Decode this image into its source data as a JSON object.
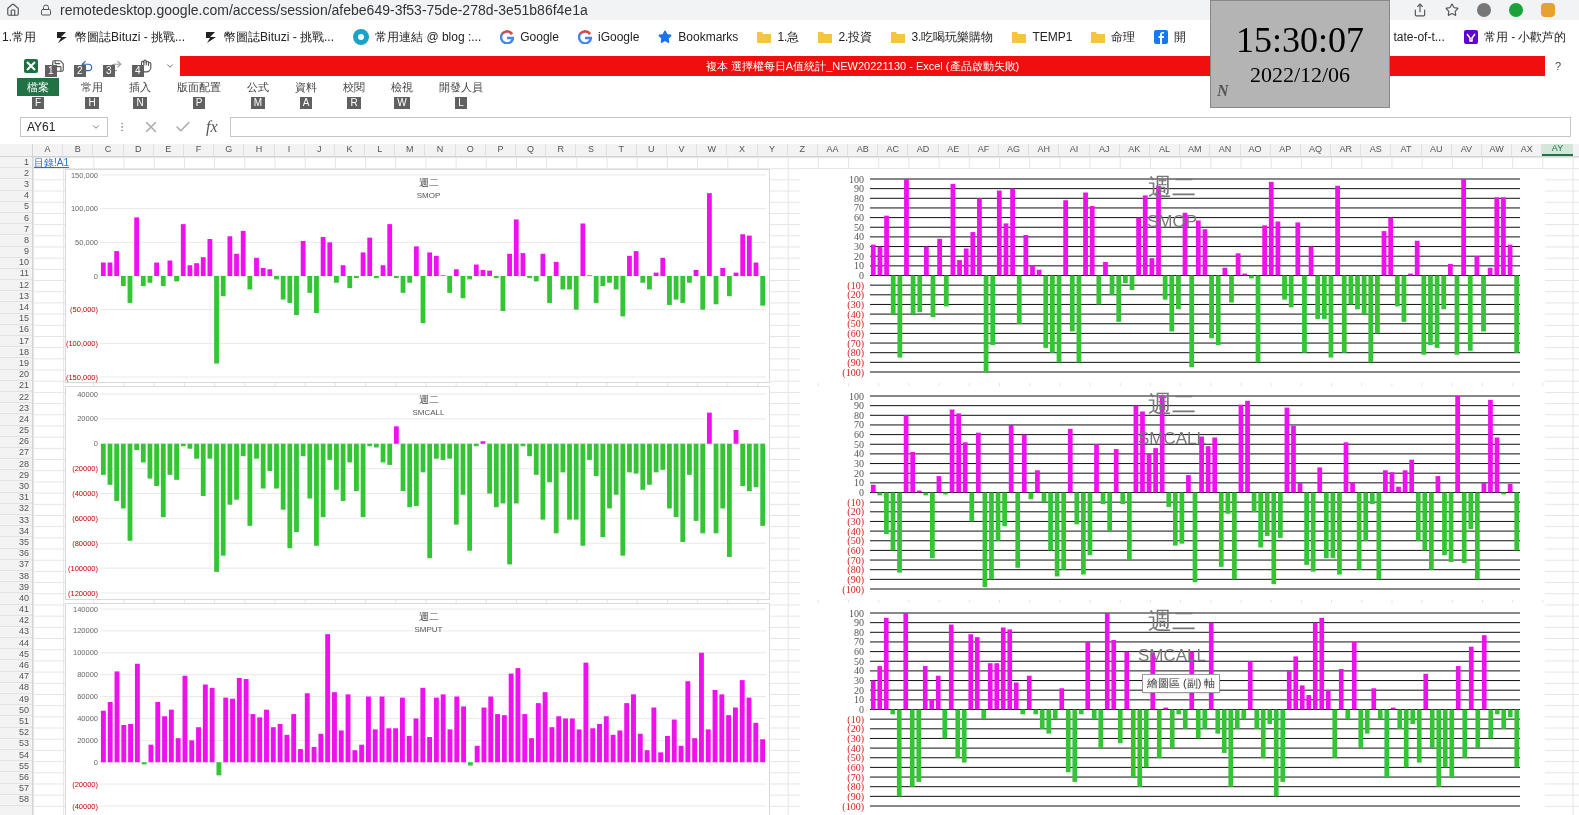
{
  "browser": {
    "url": "remotedesktop.google.com/access/session/afebe649-3f53-75de-278d-3e51b86f4e1a",
    "bookmarks": [
      {
        "kind": "plain",
        "label": "1.常用"
      },
      {
        "kind": "bituzi",
        "label": "幣圖誌Bituzi - 挑戰..."
      },
      {
        "kind": "bituzi",
        "label": "幣圖誌Bituzi - 挑戰..."
      },
      {
        "kind": "blog",
        "label": "常用連結 @ blog :..."
      },
      {
        "kind": "google",
        "label": "Google"
      },
      {
        "kind": "google",
        "label": "iGoogle"
      },
      {
        "kind": "star",
        "label": "Bookmarks"
      },
      {
        "kind": "folder",
        "label": "1.急"
      },
      {
        "kind": "folder",
        "label": "2.投資"
      },
      {
        "kind": "folder",
        "label": "3.吃喝玩樂購物"
      },
      {
        "kind": "folder",
        "label": "TEMP1"
      },
      {
        "kind": "folder",
        "label": "命理"
      },
      {
        "kind": "facebook",
        "label": "開"
      },
      {
        "kind": "plain",
        "label": "tate-of-t..."
      },
      {
        "kind": "yahoo",
        "label": "常用 - 小歡芦的"
      }
    ]
  },
  "clock": {
    "time": "15:30:07",
    "date": "2022/12/06",
    "mark": "N"
  },
  "excel": {
    "title": "複本 選擇權每日A值統計_NEW20221130 -  Excel (產品啟動失敗)",
    "help": "?",
    "quick_access": [
      {
        "kind": "save",
        "keytip": "1"
      },
      {
        "kind": "undo",
        "keytip": "2"
      },
      {
        "kind": "redo",
        "keytip": "3"
      },
      {
        "kind": "touch",
        "keytip": "4"
      }
    ],
    "tabs": [
      {
        "kind": "file",
        "label": "檔案",
        "keytip": "F"
      },
      {
        "kind": "tab",
        "label": "常用",
        "keytip": "H"
      },
      {
        "kind": "tab",
        "label": "插入",
        "keytip": "N"
      },
      {
        "kind": "tab",
        "label": "版面配置",
        "keytip": "P"
      },
      {
        "kind": "tab",
        "label": "公式",
        "keytip": "M"
      },
      {
        "kind": "tab",
        "label": "資料",
        "keytip": "A"
      },
      {
        "kind": "tab",
        "label": "校閱",
        "keytip": "R"
      },
      {
        "kind": "tab",
        "label": "檢視",
        "keytip": "W"
      },
      {
        "kind": "tab",
        "label": "開發人員",
        "keytip": "L"
      }
    ],
    "name_box": "AY61",
    "fx": "fx",
    "columns": [
      {
        "label": "A",
        "selected": false
      },
      {
        "label": "B",
        "selected": false
      },
      {
        "label": "C",
        "selected": false
      },
      {
        "label": "D",
        "selected": false
      },
      {
        "label": "E",
        "selected": false
      },
      {
        "label": "F",
        "selected": false
      },
      {
        "label": "G",
        "selected": false
      },
      {
        "label": "H",
        "selected": false
      },
      {
        "label": "I",
        "selected": false
      },
      {
        "label": "J",
        "selected": false
      },
      {
        "label": "K",
        "selected": false
      },
      {
        "label": "L",
        "selected": false
      },
      {
        "label": "M",
        "selected": false
      },
      {
        "label": "N",
        "selected": false
      },
      {
        "label": "O",
        "selected": false
      },
      {
        "label": "P",
        "selected": false
      },
      {
        "label": "Q",
        "selected": false
      },
      {
        "label": "R",
        "selected": false
      },
      {
        "label": "S",
        "selected": false
      },
      {
        "label": "T",
        "selected": false
      },
      {
        "label": "U",
        "selected": false
      },
      {
        "label": "V",
        "selected": false
      },
      {
        "label": "W",
        "selected": false
      },
      {
        "label": "X",
        "selected": false
      },
      {
        "label": "Y",
        "selected": false
      },
      {
        "label": "Z",
        "selected": false
      },
      {
        "label": "AA",
        "selected": false
      },
      {
        "label": "AB",
        "selected": false
      },
      {
        "label": "AC",
        "selected": false
      },
      {
        "label": "AD",
        "selected": false
      },
      {
        "label": "AE",
        "selected": false
      },
      {
        "label": "AF",
        "selected": false
      },
      {
        "label": "AG",
        "selected": false
      },
      {
        "label": "AH",
        "selected": false
      },
      {
        "label": "AI",
        "selected": false
      },
      {
        "label": "AJ",
        "selected": false
      },
      {
        "label": "AK",
        "selected": false
      },
      {
        "label": "AL",
        "selected": false
      },
      {
        "label": "AM",
        "selected": false
      },
      {
        "label": "AN",
        "selected": false
      },
      {
        "label": "AO",
        "selected": false
      },
      {
        "label": "AP",
        "selected": false
      },
      {
        "label": "AQ",
        "selected": false
      },
      {
        "label": "AR",
        "selected": false
      },
      {
        "label": "AS",
        "selected": false
      },
      {
        "label": "AT",
        "selected": false
      },
      {
        "label": "AU",
        "selected": false
      },
      {
        "label": "AV",
        "selected": false
      },
      {
        "label": "AW",
        "selected": false
      },
      {
        "label": "AX",
        "selected": false
      },
      {
        "label": "AY",
        "selected": true
      }
    ],
    "rows": [
      "1",
      "2",
      "3",
      "4",
      "5",
      "6",
      "7",
      "8",
      "9",
      "10",
      "11",
      "12",
      "13",
      "14",
      "15",
      "16",
      "17",
      "18",
      "19",
      "20",
      "21",
      "22",
      "23",
      "24",
      "25",
      "26",
      "27",
      "28",
      "29",
      "30",
      "31",
      "32",
      "33",
      "34",
      "35",
      "36",
      "37",
      "38",
      "39",
      "40",
      "41",
      "42",
      "43",
      "44",
      "45",
      "46",
      "47",
      "48",
      "49",
      "50",
      "51",
      "52",
      "53",
      "54",
      "55",
      "56",
      "57",
      "58"
    ],
    "cell_a1": "目錄!A1",
    "charts": [
      {
        "kind": "standard",
        "title": "週二",
        "subtitle": "SMOP",
        "chart_data": {
          "type": "bar",
          "grid": true,
          "ylim": [
            -150000,
            150000
          ],
          "yticks": [
            {
              "value": 150000,
              "label": "150,000"
            },
            {
              "value": 100000,
              "label": "100,000"
            },
            {
              "value": 50000,
              "label": "50,000"
            },
            {
              "value": 0,
              "label": "0"
            },
            {
              "value": -50000,
              "label": "(50,000)"
            },
            {
              "value": -100000,
              "label": "(100,000)"
            },
            {
              "value": -150000,
              "label": "(150,000)"
            }
          ],
          "values": [
            20000,
            20000,
            37000,
            -15000,
            -40000,
            87000,
            -15000,
            -10000,
            20000,
            -15000,
            23000,
            -8000,
            77000,
            16000,
            19000,
            28000,
            55000,
            -130000,
            -30000,
            59000,
            33000,
            67000,
            -20000,
            27000,
            12000,
            10000,
            -5000,
            -35000,
            -40000,
            -58000,
            52000,
            -25000,
            -55000,
            58000,
            50000,
            -10000,
            16000,
            -18000,
            -3000,
            35000,
            57000,
            -3000,
            16000,
            77000,
            -3000,
            -25000,
            -10000,
            44000,
            -70000,
            35000,
            30000,
            1000,
            -25000,
            10000,
            -33000,
            -5000,
            17000,
            9000,
            8000,
            -3000,
            -52000,
            33000,
            84000,
            34000,
            -3000,
            -8000,
            33000,
            -40000,
            21000,
            -20000,
            -20000,
            -50000,
            78000,
            1000,
            -40000,
            -15000,
            -10000,
            -20000,
            -60000,
            30000,
            37000,
            -10000,
            -20000,
            5000,
            27000,
            -43000,
            -35000,
            -40000,
            -10000,
            9000,
            -50000,
            123000,
            -42000,
            12000,
            -30000,
            5000,
            62000,
            60000,
            20000,
            -44000
          ]
        }
      },
      {
        "kind": "percent",
        "title": "週二",
        "subtitle": "SMOP",
        "chart_data": {
          "type": "bar",
          "grid": true,
          "ylim": [
            -100,
            100
          ],
          "yticks": [
            100,
            90,
            80,
            70,
            60,
            50,
            40,
            30,
            20,
            10,
            0,
            {
              "value": -10,
              "label": "(10)"
            },
            {
              "value": -20,
              "label": "(20)"
            },
            {
              "value": -30,
              "label": "(30)"
            },
            {
              "value": -40,
              "label": "(40)"
            },
            {
              "value": -50,
              "label": "(50)"
            },
            {
              "value": -60,
              "label": "(60)"
            },
            {
              "value": -70,
              "label": "(70)"
            },
            {
              "value": -80,
              "label": "(80)"
            },
            {
              "value": -90,
              "label": "(90)"
            },
            {
              "value": -100,
              "label": "(100)"
            }
          ],
          "values": [
            32,
            30,
            62,
            -40,
            -85,
            100,
            -40,
            -38,
            30,
            -43,
            38,
            -32,
            95,
            16,
            28,
            45,
            80,
            -100,
            -72,
            88,
            54,
            90,
            -50,
            42,
            10,
            6,
            -75,
            -80,
            -90,
            78,
            -58,
            -90,
            86,
            72,
            -30,
            14,
            -20,
            -48,
            -8,
            -15,
            60,
            83,
            18,
            93,
            -25,
            -58,
            -35,
            65,
            -95,
            57,
            48,
            -65,
            -72,
            8,
            -28,
            23,
            2,
            -3,
            -90,
            52,
            97,
            56,
            -25,
            -33,
            55,
            -80,
            30,
            -45,
            -45,
            -85,
            93,
            -80,
            -30,
            -35,
            -40,
            -90,
            -60,
            46,
            60,
            -32,
            -48,
            2,
            36,
            -82,
            -72,
            -75,
            -35,
            12,
            -82,
            100,
            -78,
            20,
            -58,
            8,
            81,
            81,
            32,
            -80
          ]
        }
      },
      {
        "kind": "standard",
        "title": "週二",
        "subtitle": "SMCALL",
        "chart_data": {
          "type": "bar",
          "grid": true,
          "ylim": [
            -120000,
            40000
          ],
          "yticks": [
            40000,
            20000,
            0,
            {
              "value": -20000,
              "label": "(20000)"
            },
            {
              "value": -40000,
              "label": "(40000)"
            },
            {
              "value": -60000,
              "label": "(60000)"
            },
            {
              "value": -80000,
              "label": "(80000)"
            },
            {
              "value": -100000,
              "label": "(100000)"
            },
            {
              "value": -120000,
              "label": "(120000)"
            }
          ],
          "values": [
            -25000,
            -33000,
            -46000,
            -52000,
            -78000,
            -5000,
            -15000,
            -28000,
            -34000,
            -59000,
            -25000,
            -29000,
            -2000,
            -4000,
            -12000,
            -42000,
            -12000,
            -103000,
            -90000,
            -49000,
            -45000,
            -10000,
            -66000,
            -12000,
            -36000,
            -22000,
            -36000,
            -53000,
            -84000,
            -71000,
            -10000,
            -44000,
            -82000,
            -59000,
            -13000,
            -37000,
            -46000,
            -15000,
            -38000,
            -59000,
            -2000,
            -3000,
            -15000,
            -17000,
            14000,
            -38000,
            -51000,
            -50000,
            -23000,
            -92000,
            -12000,
            -13000,
            -12000,
            -65000,
            -41000,
            -86000,
            -2000,
            2000,
            -40000,
            -51000,
            -48000,
            -97000,
            -48000,
            -2000,
            -10000,
            -25000,
            -61000,
            -31000,
            -72000,
            -23000,
            -61000,
            -61000,
            -82000,
            -13000,
            -26000,
            -75000,
            -52000,
            -41000,
            -90000,
            -23000,
            -24000,
            -37000,
            -33000,
            -23000,
            -21000,
            -52000,
            -59000,
            -79000,
            -25000,
            -62000,
            -72000,
            25000,
            -72000,
            -52000,
            -91000,
            11000,
            -34000,
            -38000,
            -35000,
            -66000
          ]
        }
      },
      {
        "kind": "percent",
        "title": "週二",
        "subtitle": "SMCALL",
        "chart_data": {
          "type": "bar",
          "grid": true,
          "ylim": [
            -100,
            100
          ],
          "yticks": [
            100,
            90,
            80,
            70,
            60,
            50,
            40,
            30,
            20,
            10,
            0,
            {
              "value": -10,
              "label": "(10)"
            },
            {
              "value": -20,
              "label": "(20)"
            },
            {
              "value": -30,
              "label": "(30)"
            },
            {
              "value": -40,
              "label": "(40)"
            },
            {
              "value": -50,
              "label": "(50)"
            },
            {
              "value": -60,
              "label": "(60)"
            },
            {
              "value": -70,
              "label": "(70)"
            },
            {
              "value": -80,
              "label": "(80)"
            },
            {
              "value": -90,
              "label": "(90)"
            },
            {
              "value": -100,
              "label": "(100)"
            }
          ],
          "values": [
            8,
            -3,
            -43,
            -60,
            -83,
            80,
            42,
            2,
            -3,
            -68,
            17,
            -2,
            86,
            82,
            52,
            -30,
            62,
            -98,
            -90,
            -50,
            -35,
            70,
            -78,
            60,
            -7,
            23,
            -10,
            -60,
            -87,
            -80,
            66,
            -33,
            -85,
            -65,
            50,
            -12,
            -40,
            45,
            -12,
            -70,
            90,
            84,
            40,
            46,
            100,
            -15,
            -55,
            -53,
            18,
            -93,
            58,
            48,
            57,
            -77,
            -22,
            -90,
            91,
            95,
            -20,
            -57,
            -45,
            -95,
            -47,
            88,
            69,
            10,
            -75,
            -82,
            26,
            -68,
            -68,
            -85,
            52,
            10,
            -80,
            -50,
            -12,
            -90,
            23,
            21,
            6,
            23,
            34,
            -50,
            -60,
            -80,
            17,
            -65,
            -72,
            100,
            -73,
            -38,
            -90,
            10,
            96,
            57,
            -2,
            9,
            -60
          ]
        }
      },
      {
        "kind": "standard",
        "title": "週二",
        "subtitle": "SMPUT",
        "chart_data": {
          "type": "bar",
          "grid": true,
          "ylim": [
            -40000,
            140000
          ],
          "yticks": [
            140000,
            120000,
            100000,
            80000,
            60000,
            40000,
            20000,
            0,
            {
              "value": -20000,
              "label": "(20000)"
            },
            {
              "value": -40000,
              "label": "(40000)"
            }
          ],
          "values": [
            47000,
            55000,
            83000,
            34000,
            35000,
            90000,
            -2000,
            16000,
            55000,
            42000,
            48000,
            22000,
            79000,
            20000,
            32000,
            71000,
            68000,
            -12000,
            59000,
            58000,
            77000,
            76000,
            44000,
            41000,
            48000,
            32000,
            35000,
            25000,
            44000,
            12000,
            63000,
            14000,
            26000,
            117000,
            64000,
            29000,
            62000,
            11000,
            16000,
            60000,
            30000,
            60000,
            31000,
            31000,
            59000,
            24000,
            40000,
            68000,
            23000,
            59000,
            62000,
            30000,
            60000,
            51000,
            -3000,
            15000,
            50000,
            60000,
            44000,
            43000,
            81000,
            86000,
            44000,
            22000,
            54000,
            64000,
            32000,
            42000,
            40000,
            40000,
            30000,
            91000,
            31000,
            35000,
            42000,
            25000,
            29000,
            54000,
            62000,
            26000,
            11000,
            50000,
            9000,
            24000,
            39000,
            15000,
            74000,
            22000,
            100000,
            30000,
            66000,
            62000,
            43000,
            50000,
            75000,
            59000,
            36000,
            21000
          ]
        }
      },
      {
        "kind": "percent",
        "title": "週二",
        "subtitle": "SMCALL",
        "tooltip": "繪圖區 (副) 軸",
        "chart_data": {
          "type": "bar",
          "grid": true,
          "ylim": [
            -100,
            100
          ],
          "yticks": [
            100,
            90,
            80,
            70,
            60,
            50,
            40,
            30,
            20,
            10,
            0,
            {
              "value": -10,
              "label": "(10)"
            },
            {
              "value": -20,
              "label": "(20)"
            },
            {
              "value": -30,
              "label": "(30)"
            },
            {
              "value": -40,
              "label": "(40)"
            },
            {
              "value": -50,
              "label": "(50)"
            },
            {
              "value": -60,
              "label": "(60)"
            },
            {
              "value": -70,
              "label": "(70)"
            },
            {
              "value": -80,
              "label": "(80)"
            },
            {
              "value": -90,
              "label": "(90)"
            },
            {
              "value": -100,
              "label": "(100)"
            }
          ],
          "values": [
            30,
            45,
            95,
            -5,
            -90,
            100,
            -80,
            -75,
            45,
            10,
            35,
            -30,
            88,
            -50,
            -55,
            78,
            75,
            -10,
            48,
            48,
            85,
            83,
            28,
            -5,
            35,
            -5,
            -20,
            -25,
            -10,
            22,
            -65,
            -75,
            -5,
            70,
            -10,
            -40,
            100,
            72,
            -35,
            60,
            -70,
            -80,
            -60,
            59,
            -50,
            2,
            -40,
            -5,
            -20,
            60,
            -30,
            -20,
            90,
            -25,
            -45,
            -80,
            -20,
            -10,
            50,
            -20,
            -50,
            -15,
            -90,
            -75,
            40,
            55,
            25,
            15,
            90,
            95,
            20,
            -50,
            42,
            -10,
            70,
            -40,
            -25,
            22,
            -10,
            -70,
            2,
            -20,
            -60,
            -15,
            -55,
            37,
            -40,
            -80,
            -60,
            -70,
            45,
            -50,
            65,
            -40,
            77,
            -30,
            -5,
            -20,
            -8,
            -60
          ]
        }
      }
    ]
  }
}
